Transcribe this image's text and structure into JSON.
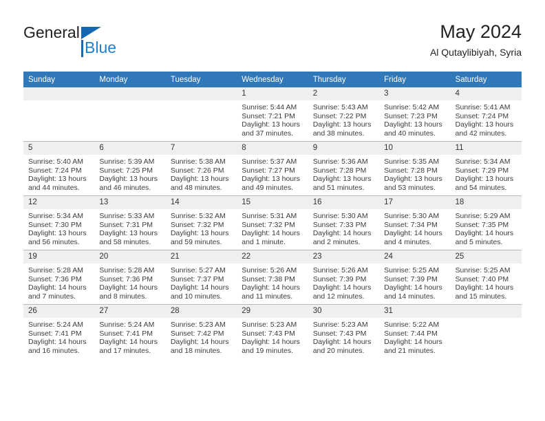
{
  "brand": {
    "name_primary": "General",
    "name_secondary": "Blue"
  },
  "header": {
    "title": "May 2024",
    "subtitle": "Al Qutaylibiyah, Syria"
  },
  "weekday_headers": [
    "Sunday",
    "Monday",
    "Tuesday",
    "Wednesday",
    "Thursday",
    "Friday",
    "Saturday"
  ],
  "colors": {
    "header_blue": "#3178b9",
    "date_strip": "#efefef",
    "brand_blue": "#1f7fd1",
    "grid_line": "#b8b8b8"
  },
  "weeks": [
    [
      {
        "day": "",
        "empty": true,
        "sunrise": "",
        "sunset": "",
        "daylight_line1": "",
        "daylight_line2": ""
      },
      {
        "day": "",
        "empty": true,
        "sunrise": "",
        "sunset": "",
        "daylight_line1": "",
        "daylight_line2": ""
      },
      {
        "day": "",
        "empty": true,
        "sunrise": "",
        "sunset": "",
        "daylight_line1": "",
        "daylight_line2": ""
      },
      {
        "day": "1",
        "empty": false,
        "sunrise": "Sunrise: 5:44 AM",
        "sunset": "Sunset: 7:21 PM",
        "daylight_line1": "Daylight: 13 hours",
        "daylight_line2": "and 37 minutes."
      },
      {
        "day": "2",
        "empty": false,
        "sunrise": "Sunrise: 5:43 AM",
        "sunset": "Sunset: 7:22 PM",
        "daylight_line1": "Daylight: 13 hours",
        "daylight_line2": "and 38 minutes."
      },
      {
        "day": "3",
        "empty": false,
        "sunrise": "Sunrise: 5:42 AM",
        "sunset": "Sunset: 7:23 PM",
        "daylight_line1": "Daylight: 13 hours",
        "daylight_line2": "and 40 minutes."
      },
      {
        "day": "4",
        "empty": false,
        "sunrise": "Sunrise: 5:41 AM",
        "sunset": "Sunset: 7:24 PM",
        "daylight_line1": "Daylight: 13 hours",
        "daylight_line2": "and 42 minutes."
      }
    ],
    [
      {
        "day": "5",
        "empty": false,
        "sunrise": "Sunrise: 5:40 AM",
        "sunset": "Sunset: 7:24 PM",
        "daylight_line1": "Daylight: 13 hours",
        "daylight_line2": "and 44 minutes."
      },
      {
        "day": "6",
        "empty": false,
        "sunrise": "Sunrise: 5:39 AM",
        "sunset": "Sunset: 7:25 PM",
        "daylight_line1": "Daylight: 13 hours",
        "daylight_line2": "and 46 minutes."
      },
      {
        "day": "7",
        "empty": false,
        "sunrise": "Sunrise: 5:38 AM",
        "sunset": "Sunset: 7:26 PM",
        "daylight_line1": "Daylight: 13 hours",
        "daylight_line2": "and 48 minutes."
      },
      {
        "day": "8",
        "empty": false,
        "sunrise": "Sunrise: 5:37 AM",
        "sunset": "Sunset: 7:27 PM",
        "daylight_line1": "Daylight: 13 hours",
        "daylight_line2": "and 49 minutes."
      },
      {
        "day": "9",
        "empty": false,
        "sunrise": "Sunrise: 5:36 AM",
        "sunset": "Sunset: 7:28 PM",
        "daylight_line1": "Daylight: 13 hours",
        "daylight_line2": "and 51 minutes."
      },
      {
        "day": "10",
        "empty": false,
        "sunrise": "Sunrise: 5:35 AM",
        "sunset": "Sunset: 7:28 PM",
        "daylight_line1": "Daylight: 13 hours",
        "daylight_line2": "and 53 minutes."
      },
      {
        "day": "11",
        "empty": false,
        "sunrise": "Sunrise: 5:34 AM",
        "sunset": "Sunset: 7:29 PM",
        "daylight_line1": "Daylight: 13 hours",
        "daylight_line2": "and 54 minutes."
      }
    ],
    [
      {
        "day": "12",
        "empty": false,
        "sunrise": "Sunrise: 5:34 AM",
        "sunset": "Sunset: 7:30 PM",
        "daylight_line1": "Daylight: 13 hours",
        "daylight_line2": "and 56 minutes."
      },
      {
        "day": "13",
        "empty": false,
        "sunrise": "Sunrise: 5:33 AM",
        "sunset": "Sunset: 7:31 PM",
        "daylight_line1": "Daylight: 13 hours",
        "daylight_line2": "and 58 minutes."
      },
      {
        "day": "14",
        "empty": false,
        "sunrise": "Sunrise: 5:32 AM",
        "sunset": "Sunset: 7:32 PM",
        "daylight_line1": "Daylight: 13 hours",
        "daylight_line2": "and 59 minutes."
      },
      {
        "day": "15",
        "empty": false,
        "sunrise": "Sunrise: 5:31 AM",
        "sunset": "Sunset: 7:32 PM",
        "daylight_line1": "Daylight: 14 hours",
        "daylight_line2": "and 1 minute."
      },
      {
        "day": "16",
        "empty": false,
        "sunrise": "Sunrise: 5:30 AM",
        "sunset": "Sunset: 7:33 PM",
        "daylight_line1": "Daylight: 14 hours",
        "daylight_line2": "and 2 minutes."
      },
      {
        "day": "17",
        "empty": false,
        "sunrise": "Sunrise: 5:30 AM",
        "sunset": "Sunset: 7:34 PM",
        "daylight_line1": "Daylight: 14 hours",
        "daylight_line2": "and 4 minutes."
      },
      {
        "day": "18",
        "empty": false,
        "sunrise": "Sunrise: 5:29 AM",
        "sunset": "Sunset: 7:35 PM",
        "daylight_line1": "Daylight: 14 hours",
        "daylight_line2": "and 5 minutes."
      }
    ],
    [
      {
        "day": "19",
        "empty": false,
        "sunrise": "Sunrise: 5:28 AM",
        "sunset": "Sunset: 7:36 PM",
        "daylight_line1": "Daylight: 14 hours",
        "daylight_line2": "and 7 minutes."
      },
      {
        "day": "20",
        "empty": false,
        "sunrise": "Sunrise: 5:28 AM",
        "sunset": "Sunset: 7:36 PM",
        "daylight_line1": "Daylight: 14 hours",
        "daylight_line2": "and 8 minutes."
      },
      {
        "day": "21",
        "empty": false,
        "sunrise": "Sunrise: 5:27 AM",
        "sunset": "Sunset: 7:37 PM",
        "daylight_line1": "Daylight: 14 hours",
        "daylight_line2": "and 10 minutes."
      },
      {
        "day": "22",
        "empty": false,
        "sunrise": "Sunrise: 5:26 AM",
        "sunset": "Sunset: 7:38 PM",
        "daylight_line1": "Daylight: 14 hours",
        "daylight_line2": "and 11 minutes."
      },
      {
        "day": "23",
        "empty": false,
        "sunrise": "Sunrise: 5:26 AM",
        "sunset": "Sunset: 7:39 PM",
        "daylight_line1": "Daylight: 14 hours",
        "daylight_line2": "and 12 minutes."
      },
      {
        "day": "24",
        "empty": false,
        "sunrise": "Sunrise: 5:25 AM",
        "sunset": "Sunset: 7:39 PM",
        "daylight_line1": "Daylight: 14 hours",
        "daylight_line2": "and 14 minutes."
      },
      {
        "day": "25",
        "empty": false,
        "sunrise": "Sunrise: 5:25 AM",
        "sunset": "Sunset: 7:40 PM",
        "daylight_line1": "Daylight: 14 hours",
        "daylight_line2": "and 15 minutes."
      }
    ],
    [
      {
        "day": "26",
        "empty": false,
        "sunrise": "Sunrise: 5:24 AM",
        "sunset": "Sunset: 7:41 PM",
        "daylight_line1": "Daylight: 14 hours",
        "daylight_line2": "and 16 minutes."
      },
      {
        "day": "27",
        "empty": false,
        "sunrise": "Sunrise: 5:24 AM",
        "sunset": "Sunset: 7:41 PM",
        "daylight_line1": "Daylight: 14 hours",
        "daylight_line2": "and 17 minutes."
      },
      {
        "day": "28",
        "empty": false,
        "sunrise": "Sunrise: 5:23 AM",
        "sunset": "Sunset: 7:42 PM",
        "daylight_line1": "Daylight: 14 hours",
        "daylight_line2": "and 18 minutes."
      },
      {
        "day": "29",
        "empty": false,
        "sunrise": "Sunrise: 5:23 AM",
        "sunset": "Sunset: 7:43 PM",
        "daylight_line1": "Daylight: 14 hours",
        "daylight_line2": "and 19 minutes."
      },
      {
        "day": "30",
        "empty": false,
        "sunrise": "Sunrise: 5:23 AM",
        "sunset": "Sunset: 7:43 PM",
        "daylight_line1": "Daylight: 14 hours",
        "daylight_line2": "and 20 minutes."
      },
      {
        "day": "31",
        "empty": false,
        "sunrise": "Sunrise: 5:22 AM",
        "sunset": "Sunset: 7:44 PM",
        "daylight_line1": "Daylight: 14 hours",
        "daylight_line2": "and 21 minutes."
      },
      {
        "day": "",
        "empty": true,
        "sunrise": "",
        "sunset": "",
        "daylight_line1": "",
        "daylight_line2": ""
      }
    ]
  ]
}
